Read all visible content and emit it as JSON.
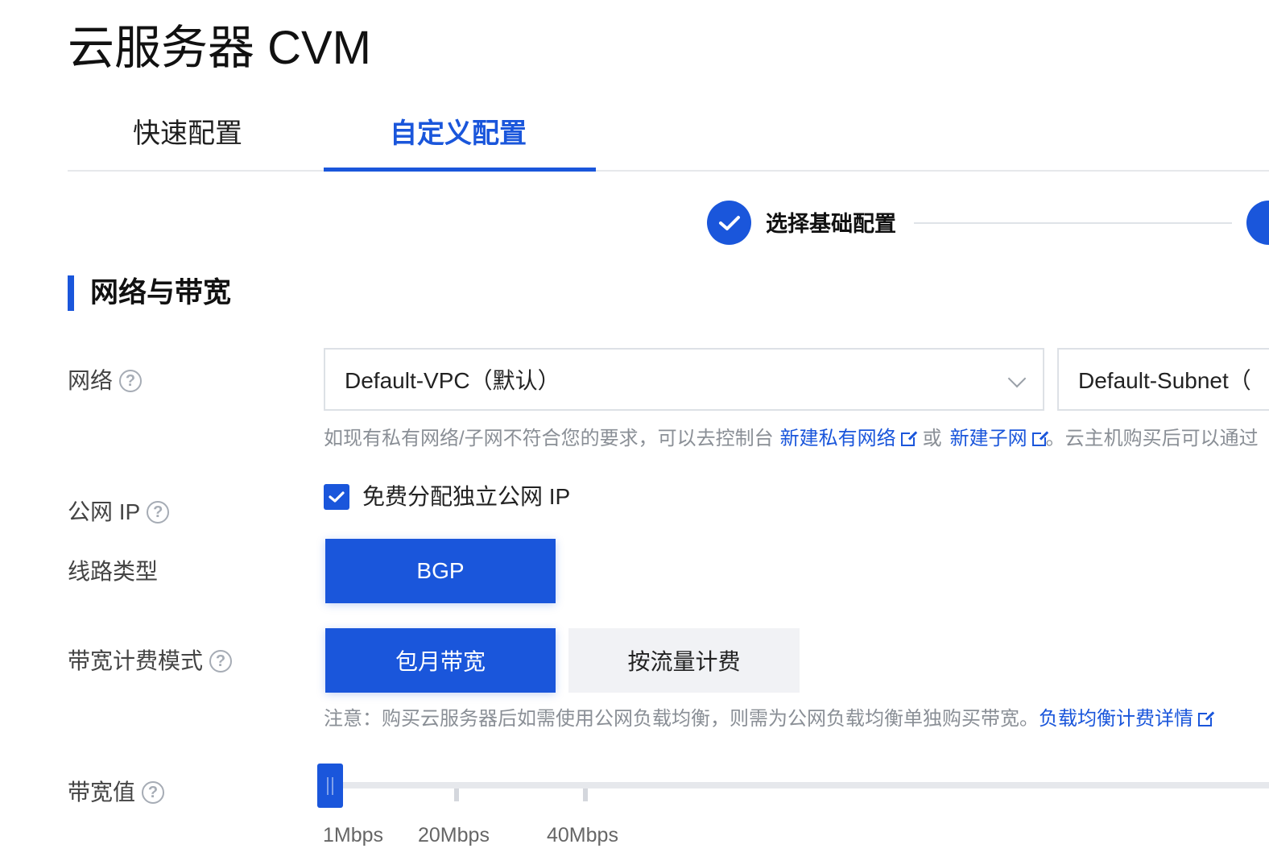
{
  "page": {
    "title": "云服务器 CVM"
  },
  "tabs": [
    {
      "label": "快速配置",
      "active": false
    },
    {
      "label": "自定义配置",
      "active": true
    }
  ],
  "steps": [
    {
      "label": "选择基础配置",
      "status": "done"
    }
  ],
  "section": {
    "title": "网络与带宽"
  },
  "network": {
    "label": "网络",
    "vpc_value": "Default-VPC（默认）",
    "subnet_value": "Default-Subnet（",
    "hint_prefix": "如现有私有网络/子网不符合您的要求，可以去控制台",
    "link_new_vpc": "新建私有网络",
    "hint_or": "或",
    "link_new_subnet": "新建子网",
    "hint_suffix": "。云主机购买后可以通过"
  },
  "public_ip": {
    "label": "公网 IP",
    "checkbox_label": "免费分配独立公网 IP",
    "checked": true
  },
  "line_type": {
    "label": "线路类型",
    "options": [
      "BGP"
    ],
    "selected": "BGP"
  },
  "billing": {
    "label": "带宽计费模式",
    "options": [
      "包月带宽",
      "按流量计费"
    ],
    "selected": "包月带宽",
    "note": "注意：购买云服务器后如需使用公网负载均衡，则需为公网负载均衡单独购买带宽。",
    "note_link": "负载均衡计费详情"
  },
  "bandwidth": {
    "label": "带宽值",
    "value_mbps": 1,
    "ticks": [
      "1Mbps",
      "20Mbps",
      "40Mbps"
    ]
  },
  "colors": {
    "primary": "#1a56db",
    "border": "#dde1e6",
    "muted": "#8a8f96"
  }
}
